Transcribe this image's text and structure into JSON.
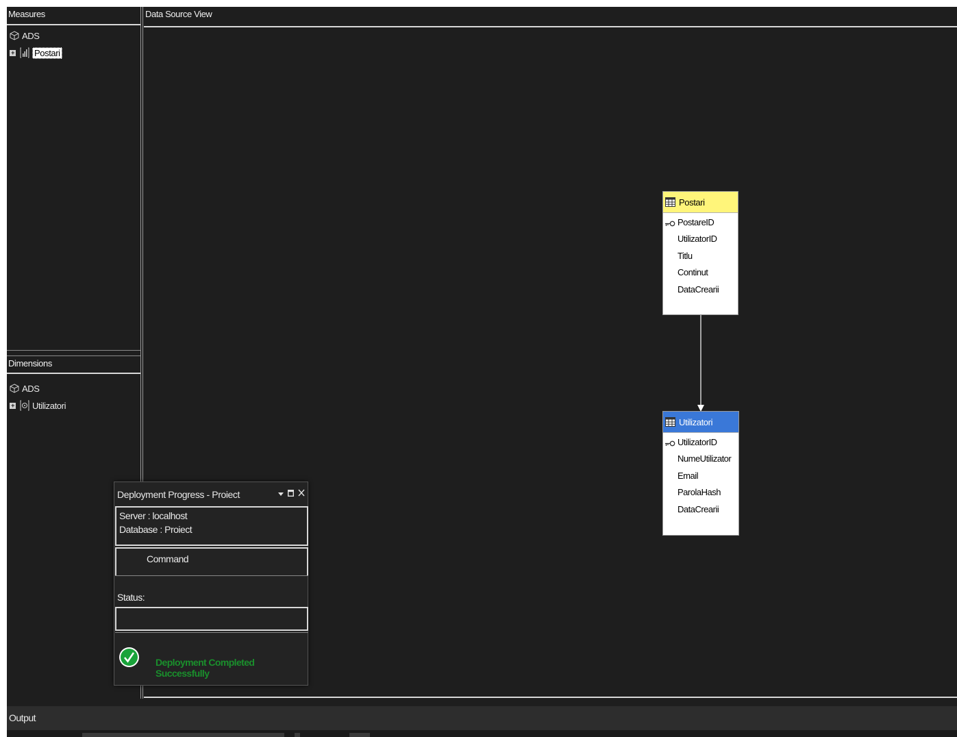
{
  "measures": {
    "header": "Measures",
    "root_label": "ADS",
    "items": [
      {
        "label": "Postari",
        "selected": true,
        "icon": "measure-group-icon"
      }
    ]
  },
  "dimensions": {
    "header": "Dimensions",
    "root_label": "ADS",
    "items": [
      {
        "label": "Utilizatori",
        "selected": false,
        "icon": "dimension-icon"
      }
    ]
  },
  "dsv": {
    "header": "Data Source View",
    "tables": [
      {
        "name": "Postari",
        "title_color": "#fff57a",
        "columns": [
          {
            "name": "PostareID",
            "key": true
          },
          {
            "name": "UtilizatorID",
            "key": false
          },
          {
            "name": "Titlu",
            "key": false
          },
          {
            "name": "Continut",
            "key": false
          },
          {
            "name": "DataCrearii",
            "key": false
          }
        ]
      },
      {
        "name": "Utilizatori",
        "title_color": "#3a78d8",
        "columns": [
          {
            "name": "UtilizatorID",
            "key": true
          },
          {
            "name": "NumeUtilizator",
            "key": false
          },
          {
            "name": "Email",
            "key": false
          },
          {
            "name": "ParolaHash",
            "key": false
          },
          {
            "name": "DataCrearii",
            "key": false
          }
        ]
      }
    ]
  },
  "deployment": {
    "title": "Deployment Progress - Proiect",
    "server_label": "Server :",
    "server_value": "localhost",
    "database_label": "Database :",
    "database_value": "Proiect",
    "command_header": "Command",
    "status_label": "Status:",
    "status_value": "",
    "result_text": "Deployment Completed Successfully",
    "result_color": "#1a8f2c"
  },
  "output": {
    "title": "Output"
  }
}
